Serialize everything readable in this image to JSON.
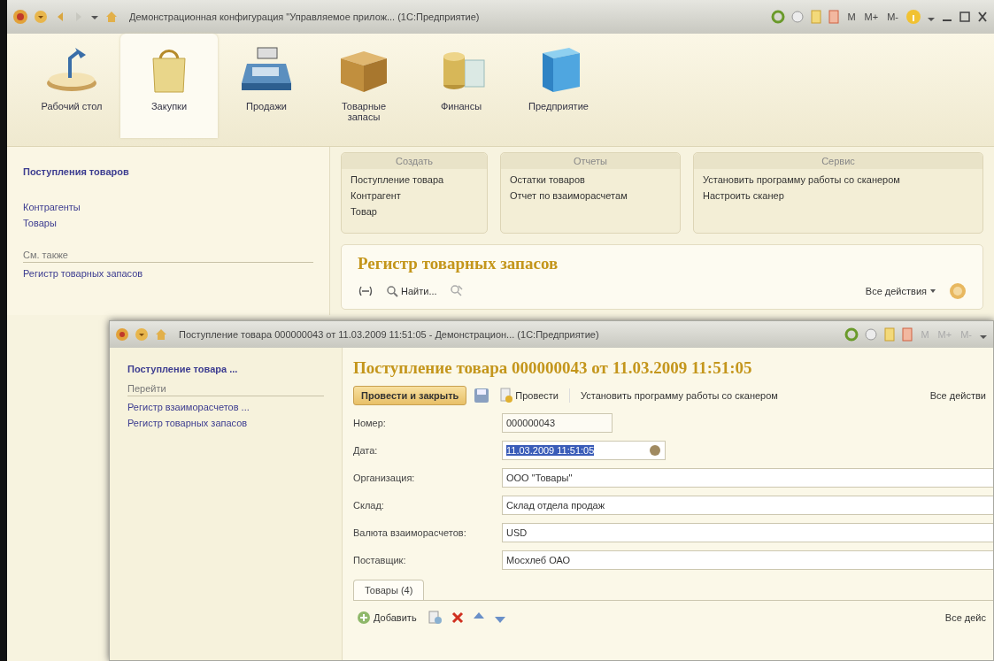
{
  "window": {
    "title": "Демонстрационная конфигурация \"Управляемое прилож...  (1С:Предприятие)",
    "memory_buttons": [
      "M",
      "M+",
      "M-"
    ]
  },
  "sections": [
    {
      "label": "Рабочий стол",
      "kind": "desk",
      "selected": false
    },
    {
      "label": "Закупки",
      "kind": "bag",
      "selected": true
    },
    {
      "label": "Продажи",
      "kind": "register",
      "selected": false
    },
    {
      "label": "Товарные запасы",
      "kind": "box",
      "selected": false
    },
    {
      "label": "Финансы",
      "kind": "coins",
      "selected": false
    },
    {
      "label": "Предприятие",
      "kind": "cube",
      "selected": false
    }
  ],
  "navigation": {
    "items": [
      {
        "label": "Поступления товаров",
        "selected": true
      },
      {
        "label": "Контрагенты",
        "selected": false
      },
      {
        "label": "Товары",
        "selected": false
      }
    ],
    "see_also": {
      "title": "См. также",
      "items": [
        "Регистр товарных запасов"
      ]
    }
  },
  "command_groups": [
    {
      "title": "Создать",
      "items": [
        "Поступление товара",
        "Контрагент",
        "Товар"
      ]
    },
    {
      "title": "Отчеты",
      "items": [
        "Остатки товаров",
        "Отчет по взаиморасчетам"
      ]
    },
    {
      "title": "Сервис",
      "items": [
        "Установить программу работы со сканером",
        "Настроить сканер"
      ]
    }
  ],
  "register": {
    "title": "Регистр товарных запасов",
    "find_button": "Найти...",
    "all_actions": "Все действия"
  },
  "document_window": {
    "title": "Поступление товара 000000043 от 11.03.2009 11:51:05 - Демонстрацион...  (1С:Предприятие)",
    "memory_buttons": [
      "M",
      "M+",
      "M-"
    ],
    "nav": {
      "current": "Поступление товара ...",
      "group": "Перейти",
      "items": [
        "Регистр взаиморасчетов ...",
        "Регистр товарных запасов"
      ]
    },
    "header": "Поступление товара 000000043 от 11.03.2009 11:51:05",
    "toolbar": {
      "post_close": "Провести и закрыть",
      "post": "Провести",
      "scanner": "Установить программу работы со сканером",
      "all_actions": "Все действи"
    },
    "fields": [
      {
        "label": "Номер:",
        "value": "000000043",
        "kind": "short",
        "highlighted": false
      },
      {
        "label": "Дата:",
        "value": "11.03.2009 11:51:05",
        "kind": "date",
        "highlighted": true
      },
      {
        "label": "Организация:",
        "value": "ООО \"Товары\"",
        "kind": "wide",
        "highlighted": false
      },
      {
        "label": "Склад:",
        "value": "Склад отдела продаж",
        "kind": "wide",
        "highlighted": false
      },
      {
        "label": "Валюта взаиморасчетов:",
        "value": "USD",
        "kind": "wide",
        "highlighted": false
      },
      {
        "label": "Поставщик:",
        "value": "Мосхлеб ОАО",
        "kind": "wide",
        "highlighted": false
      }
    ],
    "tabs": [
      {
        "label": "Товары (4)",
        "selected": true
      }
    ],
    "table_toolbar": {
      "add": "Добавить",
      "all_actions": "Все дейс"
    }
  }
}
